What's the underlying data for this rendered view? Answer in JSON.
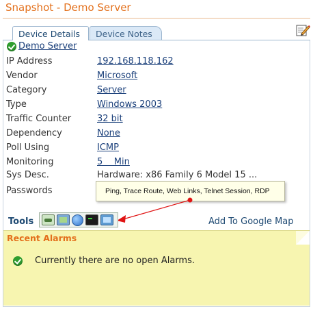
{
  "panel": {
    "title": "Snapshot - Demo Server"
  },
  "tabs": [
    {
      "label": "Device Details",
      "active": true
    },
    {
      "label": "Device Notes",
      "active": false
    }
  ],
  "device": {
    "name": "Demo Server"
  },
  "properties": [
    {
      "label": "IP Address",
      "value": "192.168.118.162",
      "link": true
    },
    {
      "label": "Vendor",
      "value": "Microsoft",
      "link": true
    },
    {
      "label": "Category",
      "value": "Server",
      "link": true
    },
    {
      "label": "Type",
      "value": "Windows 2003",
      "link": true
    },
    {
      "label": "Traffic Counter",
      "value": "32 bit",
      "link": true
    },
    {
      "label": "Dependency",
      "value": "None",
      "link": true
    },
    {
      "label": "Poll Using",
      "value": "ICMP",
      "link": true
    },
    {
      "label": "Monitoring",
      "value": "5    Min",
      "link": true
    },
    {
      "label": "Sys Desc.",
      "value": "Hardware: x86 Family 6 Model 15 ...",
      "link": false
    },
    {
      "label": "Passwords",
      "value": "",
      "link": false
    }
  ],
  "tooltip": {
    "text": "Ping, Trace Route, Web Links, Telnet Session, RDP"
  },
  "tools": {
    "label": "Tools",
    "icons": [
      "ping-icon",
      "trace-route-icon",
      "web-links-icon",
      "telnet-session-icon",
      "rdp-icon"
    ]
  },
  "google_map": {
    "label": "Add To Google Map"
  },
  "alarms": {
    "title": "Recent Alarms",
    "message": "Currently there are no open Alarms."
  },
  "colors": {
    "title": "#e3701c",
    "tab_text": "#1f4a73",
    "link": "#1a3f7a",
    "alarm_bg": "#f7f5b0",
    "pointer": "#e01414"
  }
}
